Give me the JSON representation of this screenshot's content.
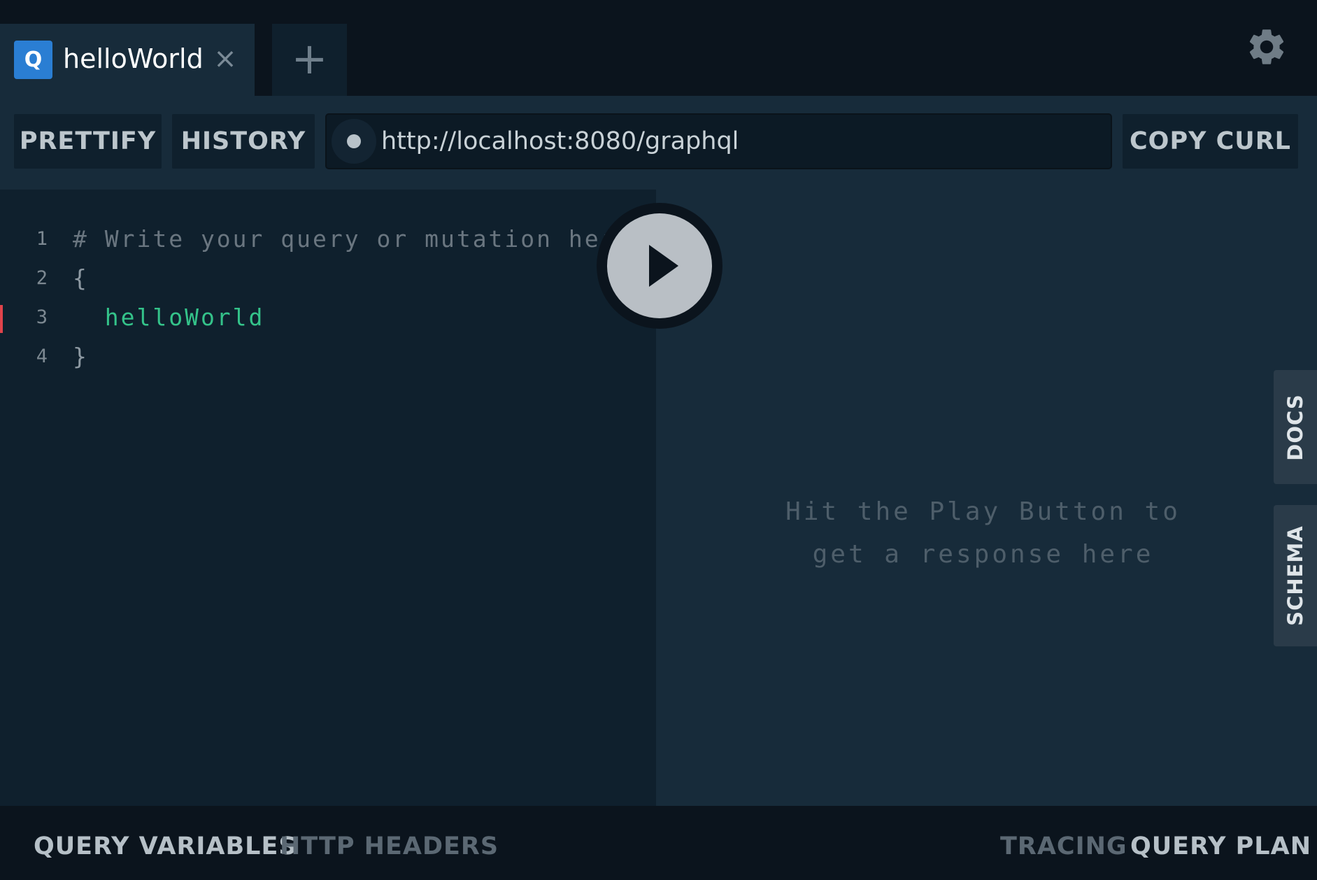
{
  "tabs": {
    "active": {
      "badge": "Q",
      "title": "helloWorld",
      "close_glyph": "×",
      "close_icon": "close-icon"
    },
    "add_glyph": "+",
    "add_icon": "plus-icon",
    "settings_icon": "gear-icon"
  },
  "toolbar": {
    "prettify_label": "PRETTIFY",
    "history_label": "HISTORY",
    "endpoint_url": "http://localhost:8080/graphql",
    "copy_curl_label": "COPY CURL"
  },
  "editor": {
    "lines": [
      {
        "num": "1",
        "text": "# Write your query or mutation her"
      },
      {
        "num": "2",
        "text": "{"
      },
      {
        "num": "3",
        "text": "  helloWorld"
      },
      {
        "num": "4",
        "text": "}"
      }
    ]
  },
  "play_icon": "play-icon",
  "response": {
    "hint_line1": "Hit the Play Button to",
    "hint_line2": "get a response here"
  },
  "side_tabs": {
    "docs_label": "DOCS",
    "schema_label": "SCHEMA"
  },
  "bottom": {
    "query_variables_label": "QUERY VARIABLES",
    "http_headers_label": "HTTP HEADERS",
    "tracing_label": "TRACING",
    "query_plan_label": "QUERY PLAN"
  },
  "colors": {
    "tab_badge": "#2a7ed3",
    "field": "#34c38a",
    "cursor": "#e0434b",
    "background": "#0f202d"
  }
}
